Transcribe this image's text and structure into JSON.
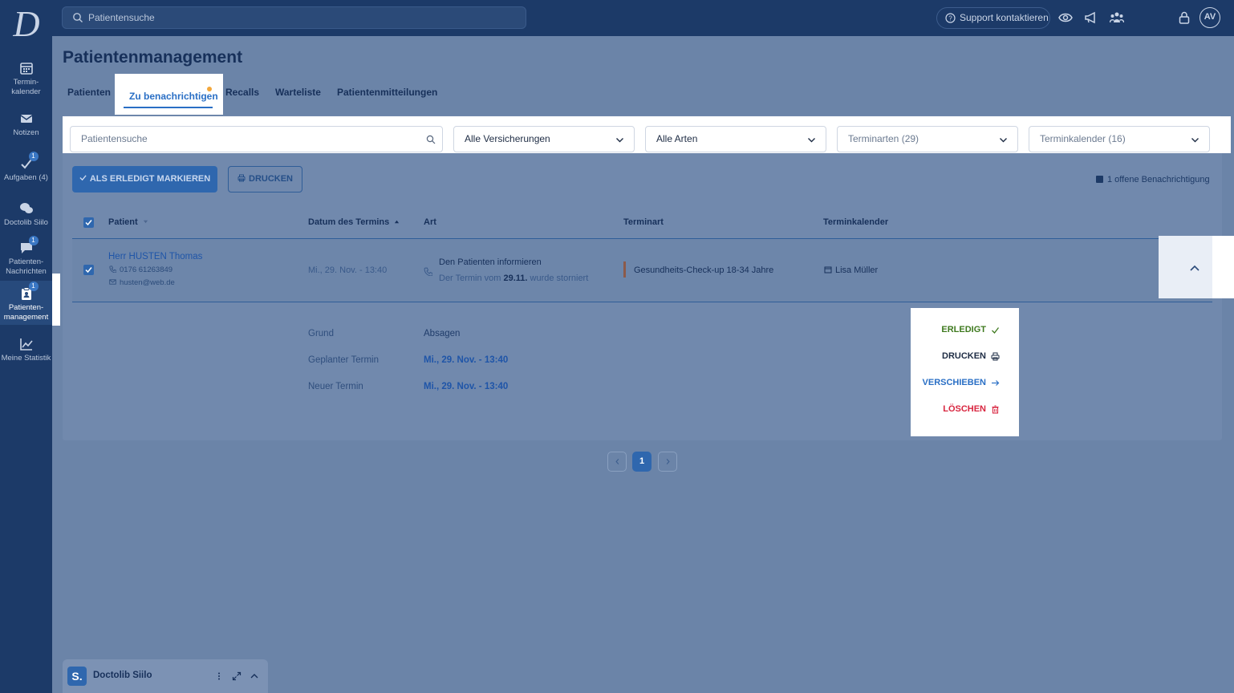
{
  "topbar": {
    "search_placeholder": "Patientensuche",
    "support_label": "Support kontaktieren",
    "avatar_initials": "AV"
  },
  "sidebar": {
    "items": [
      {
        "label_line1": "Termin-",
        "label_line2": "kalender"
      },
      {
        "label_line1": "Notizen",
        "label_line2": ""
      },
      {
        "label_line1": "Aufgaben (4)",
        "label_line2": "",
        "badge": "1"
      },
      {
        "label_line1": "Doctolib Siilo",
        "label_line2": ""
      },
      {
        "label_line1": "Patienten-",
        "label_line2": "Nachrichten",
        "badge": "1"
      },
      {
        "label_line1": "Patienten-",
        "label_line2": "management",
        "badge": "1"
      },
      {
        "label_line1": "Meine Statistik",
        "label_line2": ""
      }
    ]
  },
  "page": {
    "title": "Patientenmanagement",
    "tabs": [
      "Patienten",
      "Zu benachrichtigen",
      "Recalls",
      "Warteliste",
      "Patientenmitteilungen"
    ]
  },
  "filters": {
    "search_placeholder": "Patientensuche",
    "insurance": "Alle Versicherungen",
    "kinds": "Alle Arten",
    "appointment_types": "Terminarten (29)",
    "calendars": "Terminkalender (16)"
  },
  "actions": {
    "mark_done": "ALS ERLEDIGT MARKIEREN",
    "print": "DRUCKEN",
    "open_notice": "1 offene Benachrichtigung"
  },
  "table": {
    "headers": [
      "Patient",
      "Datum des Termins",
      "Art",
      "Terminart",
      "Terminkalender"
    ],
    "row": {
      "patient_name": "Herr HUSTEN Thomas",
      "phone": "0176 61263849",
      "email": "husten@web.de",
      "date": "Mi., 29. Nov. - 13:40",
      "art_title": "Den Patienten informieren",
      "art_sub_prefix": "Der Termin vom ",
      "art_sub_bold": "29.11.",
      "art_sub_suffix": " wurde storniert",
      "terminart": "Gesundheits-Check-up 18-34 Jahre",
      "calendar": "Lisa Müller"
    }
  },
  "details": {
    "grund_label": "Grund",
    "grund_value": "Absagen",
    "planned_label": "Geplanter Termin",
    "planned_value": "Mi., 29. Nov. - 13:40",
    "new_label": "Neuer Termin",
    "new_value": "Mi., 29. Nov. - 13:40"
  },
  "menu": {
    "done": "ERLEDIGT",
    "print": "DRUCKEN",
    "move": "VERSCHIEBEN",
    "delete": "LÖSCHEN"
  },
  "colors": {
    "done": "#3f7a1f",
    "print": "#1e2c44",
    "move": "#2a6fc5",
    "delete": "#d8253f"
  },
  "pagination": {
    "current": "1"
  },
  "widget": {
    "badge": "S.",
    "title": "Doctolib Siilo"
  }
}
